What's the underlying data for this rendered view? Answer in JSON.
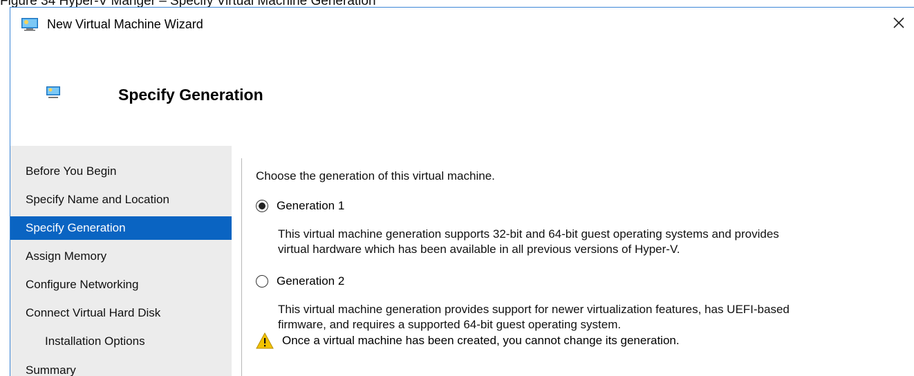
{
  "caption": "Figure 34 Hyper-V Manger – Specify Virtual Machine Generation",
  "window": {
    "title": "New Virtual Machine Wizard",
    "close_glyph": "✕"
  },
  "header": {
    "title": "Specify Generation"
  },
  "nav": {
    "items": [
      {
        "label": "Before You Begin",
        "selected": false,
        "sub": false
      },
      {
        "label": "Specify Name and Location",
        "selected": false,
        "sub": false
      },
      {
        "label": "Specify Generation",
        "selected": true,
        "sub": false
      },
      {
        "label": "Assign Memory",
        "selected": false,
        "sub": false
      },
      {
        "label": "Configure Networking",
        "selected": false,
        "sub": false
      },
      {
        "label": "Connect Virtual Hard Disk",
        "selected": false,
        "sub": false
      },
      {
        "label": "Installation Options",
        "selected": false,
        "sub": true
      },
      {
        "label": "Summary",
        "selected": false,
        "sub": false
      }
    ]
  },
  "main": {
    "prompt": "Choose the generation of this virtual machine.",
    "gen1": {
      "label": "Generation 1",
      "checked": true,
      "desc_line1": "This virtual machine generation supports 32-bit and 64-bit guest operating systems and provides",
      "desc_line2": "virtual hardware which has been available in all previous versions of Hyper-V."
    },
    "gen2": {
      "label": "Generation 2",
      "checked": false,
      "desc_line1": "This virtual machine generation provides support for newer virtualization features, has UEFI-based",
      "desc_line2": "firmware, and requires a supported 64-bit guest operating system."
    },
    "warning": "Once a virtual machine has been created, you cannot change its generation."
  },
  "colors": {
    "selection": "#0a64c2",
    "nav_background": "#ececec",
    "window_border": "#3c86d6",
    "warning": "#f2c200"
  }
}
